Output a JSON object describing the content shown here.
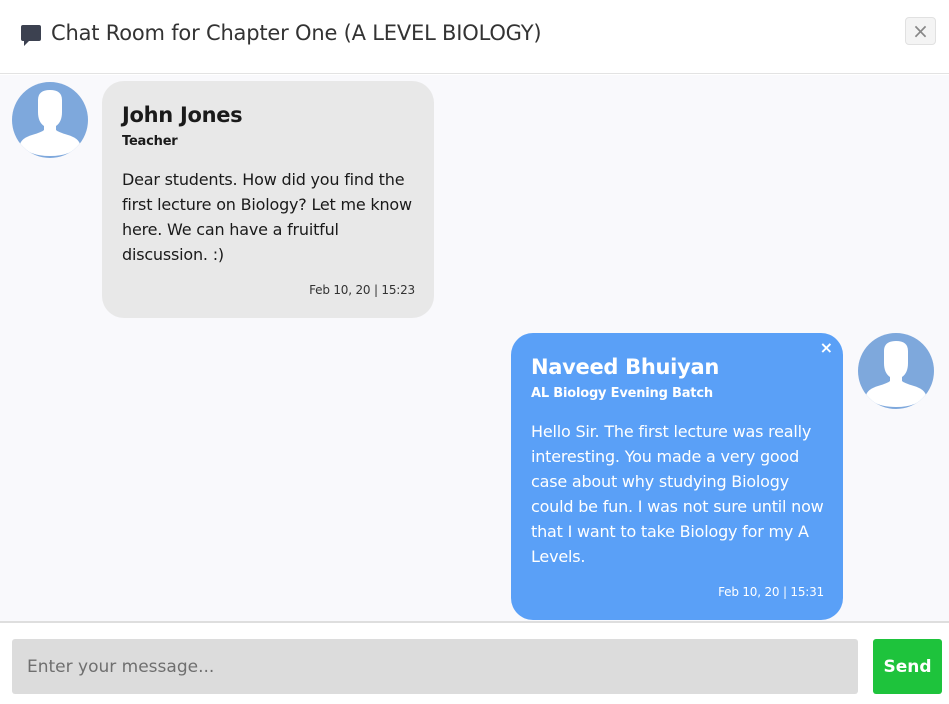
{
  "header": {
    "icon": "chat-bubble-icon",
    "title": "Chat Room for Chapter One (A LEVEL BIOLOGY)",
    "close_label": "×"
  },
  "messages": [
    {
      "sender": "John Jones",
      "role": "Teacher",
      "text": "Dear students. How did you find the first lecture on Biology? Let me know here. We can have a fruitful discussion. :)",
      "time": "Feb 10, 20 | 15:23",
      "side": "left",
      "avatar": "user-silhouette-icon"
    },
    {
      "sender": "Naveed Bhuiyan",
      "role": "AL Biology Evening Batch",
      "text": "Hello Sir. The first lecture was really interesting. You made a very good case about why studying Biology could be fun. I was not sure until now that I want to take Biology for my A Levels.",
      "time": "Feb 10, 20 | 15:31",
      "side": "right",
      "avatar": "user-silhouette-icon",
      "delete_label": "×"
    }
  ],
  "composer": {
    "placeholder": "Enter your message...",
    "value": "",
    "send_label": "Send"
  },
  "colors": {
    "own_bubble": "#5aa0f7",
    "other_bubble": "#e8e8e8",
    "send_button": "#1ec33c",
    "avatar_bg": "#7ea8dc"
  }
}
